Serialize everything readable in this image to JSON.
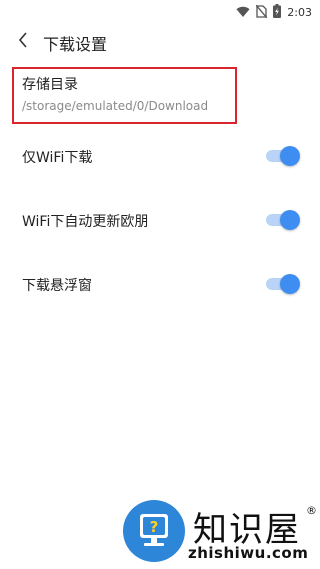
{
  "status_bar": {
    "time": "2:03",
    "icons": [
      "wifi-icon",
      "no-sim-icon",
      "battery-charging-icon"
    ]
  },
  "header": {
    "title": "下载设置",
    "back_icon": "chevron-left-icon"
  },
  "storage": {
    "label": "存储目录",
    "path": "/storage/emulated/0/Download",
    "highlight_color": "#d9262d"
  },
  "settings": [
    {
      "label": "仅WiFi下载",
      "enabled": true
    },
    {
      "label": "WiFi下自动更新欧朋",
      "enabled": true
    },
    {
      "label": "下载悬浮窗",
      "enabled": true
    }
  ],
  "colors": {
    "accent": "#3d8ef0",
    "toggle_track_on": "#b9d4f6"
  },
  "watermark": {
    "brand": "知识屋",
    "registered": "®",
    "url": "zhishiwu.com",
    "logo_icon": "question-monitor-icon"
  }
}
